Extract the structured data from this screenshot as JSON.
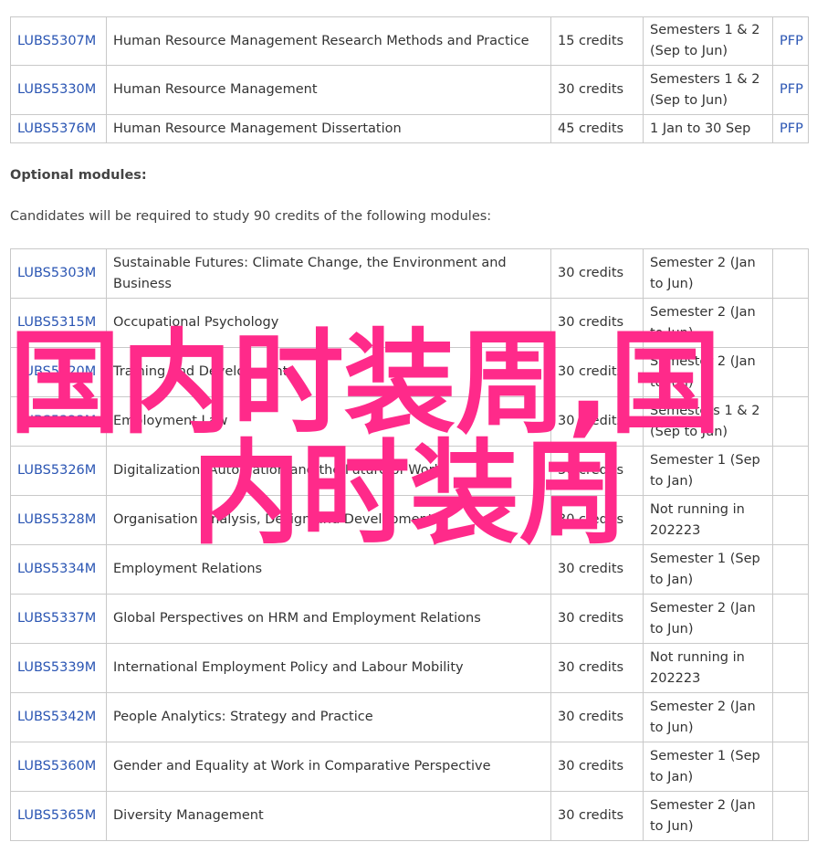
{
  "core_modules": [
    {
      "code": "LUBS5307M",
      "title": "Human Resource Management Research Methods and Practice",
      "credits": "15 credits",
      "semester": "Semesters 1 & 2 (Sep to Jun)",
      "pfp": "PFP"
    },
    {
      "code": "LUBS5330M",
      "title": "Human Resource Management",
      "credits": "30 credits",
      "semester": "Semesters 1 & 2 (Sep to Jun)",
      "pfp": "PFP"
    },
    {
      "code": "LUBS5376M",
      "title": "Human Resource Management Dissertation",
      "credits": "45 credits",
      "semester": "1 Jan to 30 Sep",
      "pfp": "PFP"
    }
  ],
  "optional": {
    "heading": "Optional modules:",
    "note": "Candidates will be required to study 90 credits of the following modules:"
  },
  "optional_modules": [
    {
      "code": "LUBS5303M",
      "title": "Sustainable Futures: Climate Change, the Environment and Business",
      "credits": "30 credits",
      "semester": "Semester 2 (Jan to Jun)"
    },
    {
      "code": "LUBS5315M",
      "title": "Occupational Psychology",
      "credits": "30 credits",
      "semester": "Semester 2 (Jan to Jun)"
    },
    {
      "code": "LUBS5320M",
      "title": "Training and Development",
      "credits": "30 credits",
      "semester": "Semester 2 (Jan to Jun)"
    },
    {
      "code": "LUBS5323M",
      "title": "Employment Law",
      "credits": "30 credits",
      "semester": "Semesters 1 & 2 (Sep to Jun)"
    },
    {
      "code": "LUBS5326M",
      "title": "Digitalization, Automation and the Future of Work",
      "credits": "30 credits",
      "semester": "Semester 1 (Sep to Jan)"
    },
    {
      "code": "LUBS5328M",
      "title": "Organisation Analysis, Design and Development",
      "credits": "30 credits",
      "semester": "Not running in 202223"
    },
    {
      "code": "LUBS5334M",
      "title": "Employment Relations",
      "credits": "30 credits",
      "semester": "Semester 1 (Sep to Jan)"
    },
    {
      "code": "LUBS5337M",
      "title": "Global Perspectives on HRM and Employment Relations",
      "credits": "30 credits",
      "semester": "Semester 2 (Jan to Jun)"
    },
    {
      "code": "LUBS5339M",
      "title": "International Employment Policy and Labour Mobility",
      "credits": "30 credits",
      "semester": "Not running in 202223"
    },
    {
      "code": "LUBS5342M",
      "title": "People Analytics: Strategy and Practice",
      "credits": "30 credits",
      "semester": "Semester 2 (Jan to Jun)"
    },
    {
      "code": "LUBS5360M",
      "title": "Gender and Equality at Work in Comparative Perspective",
      "credits": "30 credits",
      "semester": "Semester 1 (Sep to Jan)"
    },
    {
      "code": "LUBS5365M",
      "title": "Diversity Management",
      "credits": "30 credits",
      "semester": "Semester 2 (Jan to Jun)"
    }
  ],
  "watermark": {
    "line1": "国内时装周,国",
    "line2": "内时装周",
    "color": "#ff2a8a"
  }
}
